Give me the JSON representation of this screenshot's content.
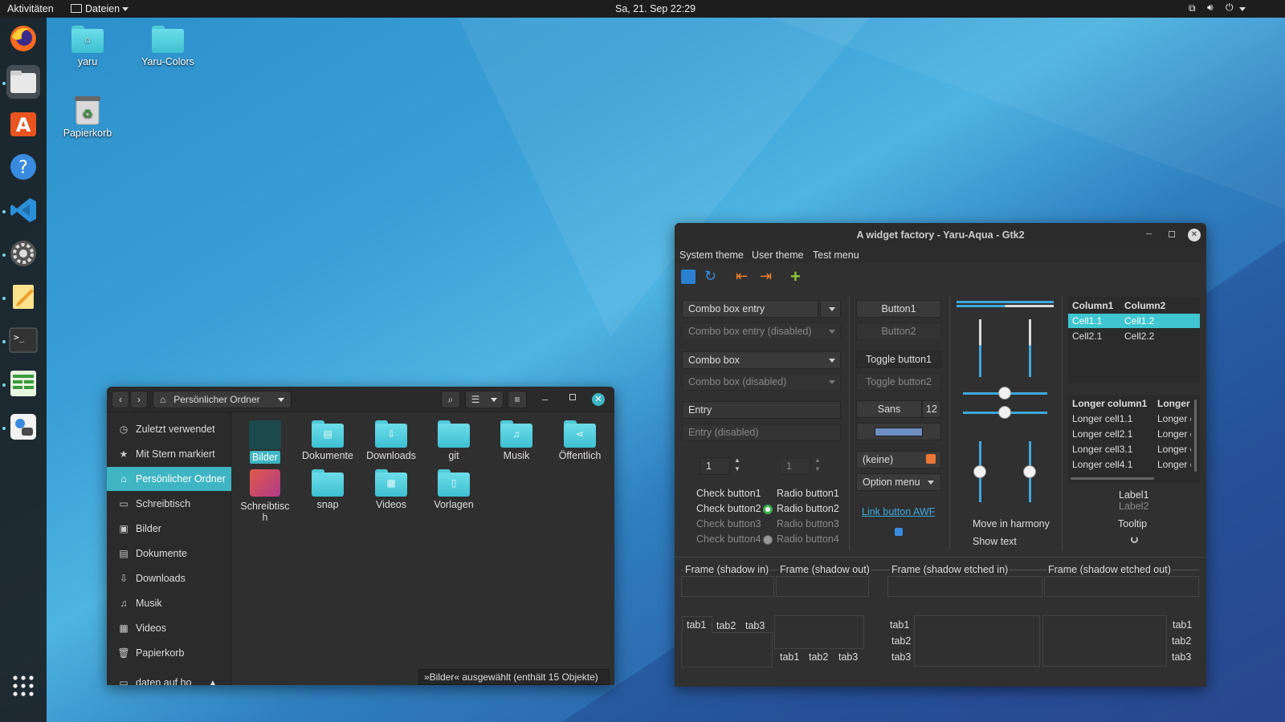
{
  "topbar": {
    "activities": "Aktivitäten",
    "app_menu": "Dateien",
    "clock": "Sa, 21. Sep  22:29"
  },
  "dock": {
    "apps": [
      "firefox-icon",
      "files-icon",
      "software-icon",
      "help-icon",
      "vscode-icon",
      "settings-icon",
      "text-editor-icon",
      "terminal-icon",
      "spreadsheet-icon",
      "extensions-icon"
    ],
    "apps_grid": "show-applications-icon"
  },
  "desktop": {
    "icons": [
      "yaru",
      "Yaru-Colors",
      "Papierkorb"
    ]
  },
  "file_manager": {
    "location": "Persönlicher Ordner",
    "sidebar": [
      "Zuletzt verwendet",
      "Mit Stern markiert",
      "Persönlicher Ordner",
      "Schreibtisch",
      "Bilder",
      "Dokumente",
      "Downloads",
      "Musik",
      "Videos",
      "Papierkorb",
      "daten auf ho"
    ],
    "files": [
      "Bilder",
      "Dokumente",
      "Downloads",
      "git",
      "Musik",
      "Öffentlich",
      "Schreibtisch",
      "snap",
      "Videos",
      "Vorlagen"
    ],
    "files_wrapped": {
      "desktop": [
        "Schreibtisc",
        "h"
      ]
    },
    "status": "»Bilder« ausgewählt  (enthält 15 Objekte)",
    "accent": "#3fb5c3"
  },
  "widget_factory": {
    "title": "A widget factory - Yaru-Aqua - Gtk2",
    "menu": [
      "System theme",
      "User theme",
      "Test menu"
    ],
    "combo_entry": "Combo box entry",
    "combo_entry_disabled": "Combo box entry (disabled)",
    "combo": "Combo box",
    "combo_disabled": "Combo box (disabled)",
    "entry": "Entry",
    "entry_disabled": "Entry (disabled)",
    "spin1": "1",
    "spin2": "1",
    "checks": [
      "Check button1",
      "Check button2",
      "Check button3",
      "Check button4"
    ],
    "radios": [
      "Radio button1",
      "Radio button2",
      "Radio button3",
      "Radio button4"
    ],
    "button1": "Button1",
    "button2": "Button2",
    "toggle1": "Toggle button1",
    "toggle2": "Toggle button2",
    "font_name": "Sans",
    "font_size": "12",
    "file_chooser": "(keine)",
    "option_menu": "Option menu",
    "link": "Link button AWF",
    "move_harmony": "Move in harmony",
    "show_text": "Show text",
    "tree1": {
      "headers": [
        "Column1",
        "Column2"
      ],
      "rows": [
        [
          "Cell1.1",
          "Cell1.2"
        ],
        [
          "Cell2.1",
          "Cell2.2"
        ]
      ]
    },
    "tree2": {
      "headers": [
        "Longer column1",
        "Longer"
      ],
      "rows": [
        [
          "Longer cell1.1",
          "Longer c"
        ],
        [
          "Longer cell2.1",
          "Longer c"
        ],
        [
          "Longer cell3.1",
          "Longer c"
        ],
        [
          "Longer cell4.1",
          "Longer c"
        ]
      ]
    },
    "label1": "Label1",
    "label2": "Label2",
    "tooltip": "Tooltip",
    "frames": [
      "Frame (shadow in)",
      "Frame (shadow out)",
      "Frame (shadow etched in)",
      "Frame (shadow etched out)"
    ],
    "tabs": [
      "tab1",
      "tab2",
      "tab3"
    ],
    "accent": "#3fa8dc"
  }
}
